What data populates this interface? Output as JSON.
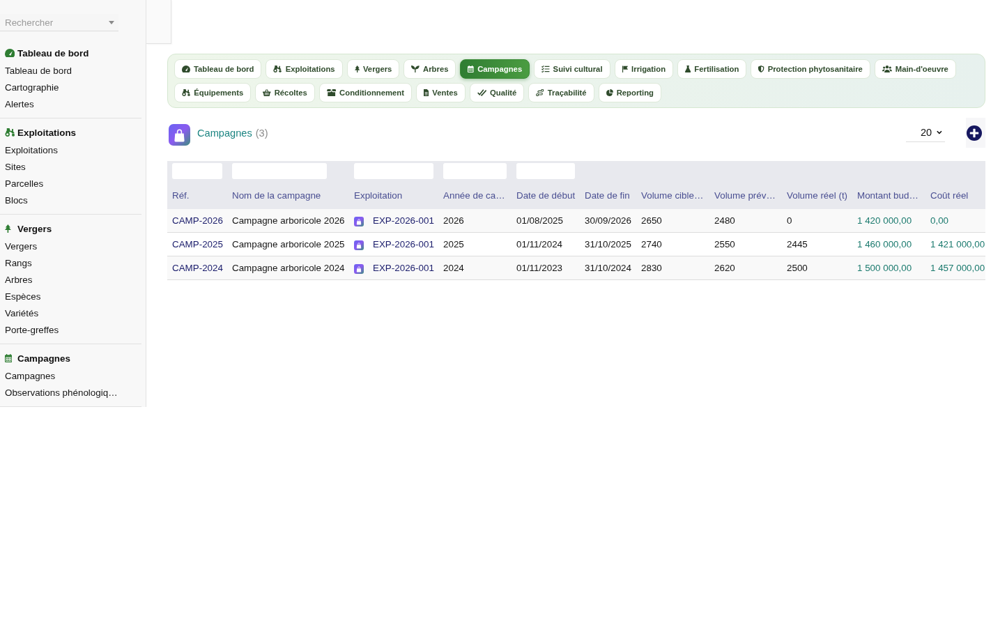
{
  "sidebar": {
    "search": {
      "placeholder": "Rechercher"
    },
    "sections": [
      {
        "title": "Tableau de bord",
        "items": [
          "Tableau de bord",
          "Cartographie",
          "Alertes"
        ]
      },
      {
        "title": "Exploitations",
        "items": [
          "Exploitations",
          "Sites",
          "Parcelles",
          "Blocs"
        ]
      },
      {
        "title": "Vergers",
        "items": [
          "Vergers",
          "Rangs",
          "Arbres",
          "Espèces",
          "Variétés",
          "Porte-greffes"
        ]
      },
      {
        "title": "Campagnes",
        "items": [
          "Campagnes",
          "Observations phénologiq…"
        ]
      }
    ]
  },
  "nav_tabs": [
    {
      "label": "Tableau de bord",
      "selected": false
    },
    {
      "label": "Exploitations",
      "selected": false
    },
    {
      "label": "Vergers",
      "selected": false
    },
    {
      "label": "Arbres",
      "selected": false
    },
    {
      "label": "Campagnes",
      "selected": true
    },
    {
      "label": "Suivi cultural",
      "selected": false
    },
    {
      "label": "Irrigation",
      "selected": false
    },
    {
      "label": "Fertilisation",
      "selected": false
    },
    {
      "label": "Protection phytosanitaire",
      "selected": false
    },
    {
      "label": "Main-d'oeuvre",
      "selected": false
    },
    {
      "label": "Équipements",
      "selected": false
    },
    {
      "label": "Récoltes",
      "selected": false
    },
    {
      "label": "Conditionnement",
      "selected": false
    },
    {
      "label": "Ventes",
      "selected": false
    },
    {
      "label": "Qualité",
      "selected": false
    },
    {
      "label": "Traçabilité",
      "selected": false
    },
    {
      "label": "Reporting",
      "selected": false
    }
  ],
  "list_header": {
    "title": "Campagnes",
    "count": "(3)",
    "page_size": "20"
  },
  "table": {
    "columns": [
      {
        "label": "Réf.",
        "kind": "link",
        "filter": true
      },
      {
        "label": "Nom de la campagne",
        "kind": "text",
        "filter": true
      },
      {
        "label": "Exploitation",
        "kind": "icon-link",
        "filter": true
      },
      {
        "label": "Année de ca…",
        "kind": "text",
        "filter": true
      },
      {
        "label": "Date de début",
        "kind": "text",
        "filter": true
      },
      {
        "label": "Date de fin",
        "kind": "text",
        "filter": false
      },
      {
        "label": "Volume cible…",
        "kind": "text",
        "filter": false
      },
      {
        "label": "Volume prév…",
        "kind": "text",
        "filter": false
      },
      {
        "label": "Volume réel (t)",
        "kind": "text",
        "filter": false
      },
      {
        "label": "Montant bud…",
        "kind": "money",
        "filter": false
      },
      {
        "label": "Coût réel",
        "kind": "money",
        "filter": false
      }
    ],
    "rows": [
      [
        "CAMP-2026",
        "Campagne arboricole 2026",
        "EXP-2026-001",
        "2026",
        "01/08/2025",
        "30/09/2026",
        "2650",
        "2480",
        "0",
        "1 420 000,00",
        "0,00"
      ],
      [
        "CAMP-2025",
        "Campagne arboricole 2025",
        "EXP-2026-001",
        "2025",
        "01/11/2024",
        "31/10/2025",
        "2740",
        "2550",
        "2445",
        "1 460 000,00",
        "1 421 000,00"
      ],
      [
        "CAMP-2024",
        "Campagne arboricole 2024",
        "EXP-2026-001",
        "2024",
        "01/11/2023",
        "31/10/2024",
        "2830",
        "2620",
        "2500",
        "1 500 000,00",
        "1 457 000,00"
      ]
    ]
  }
}
